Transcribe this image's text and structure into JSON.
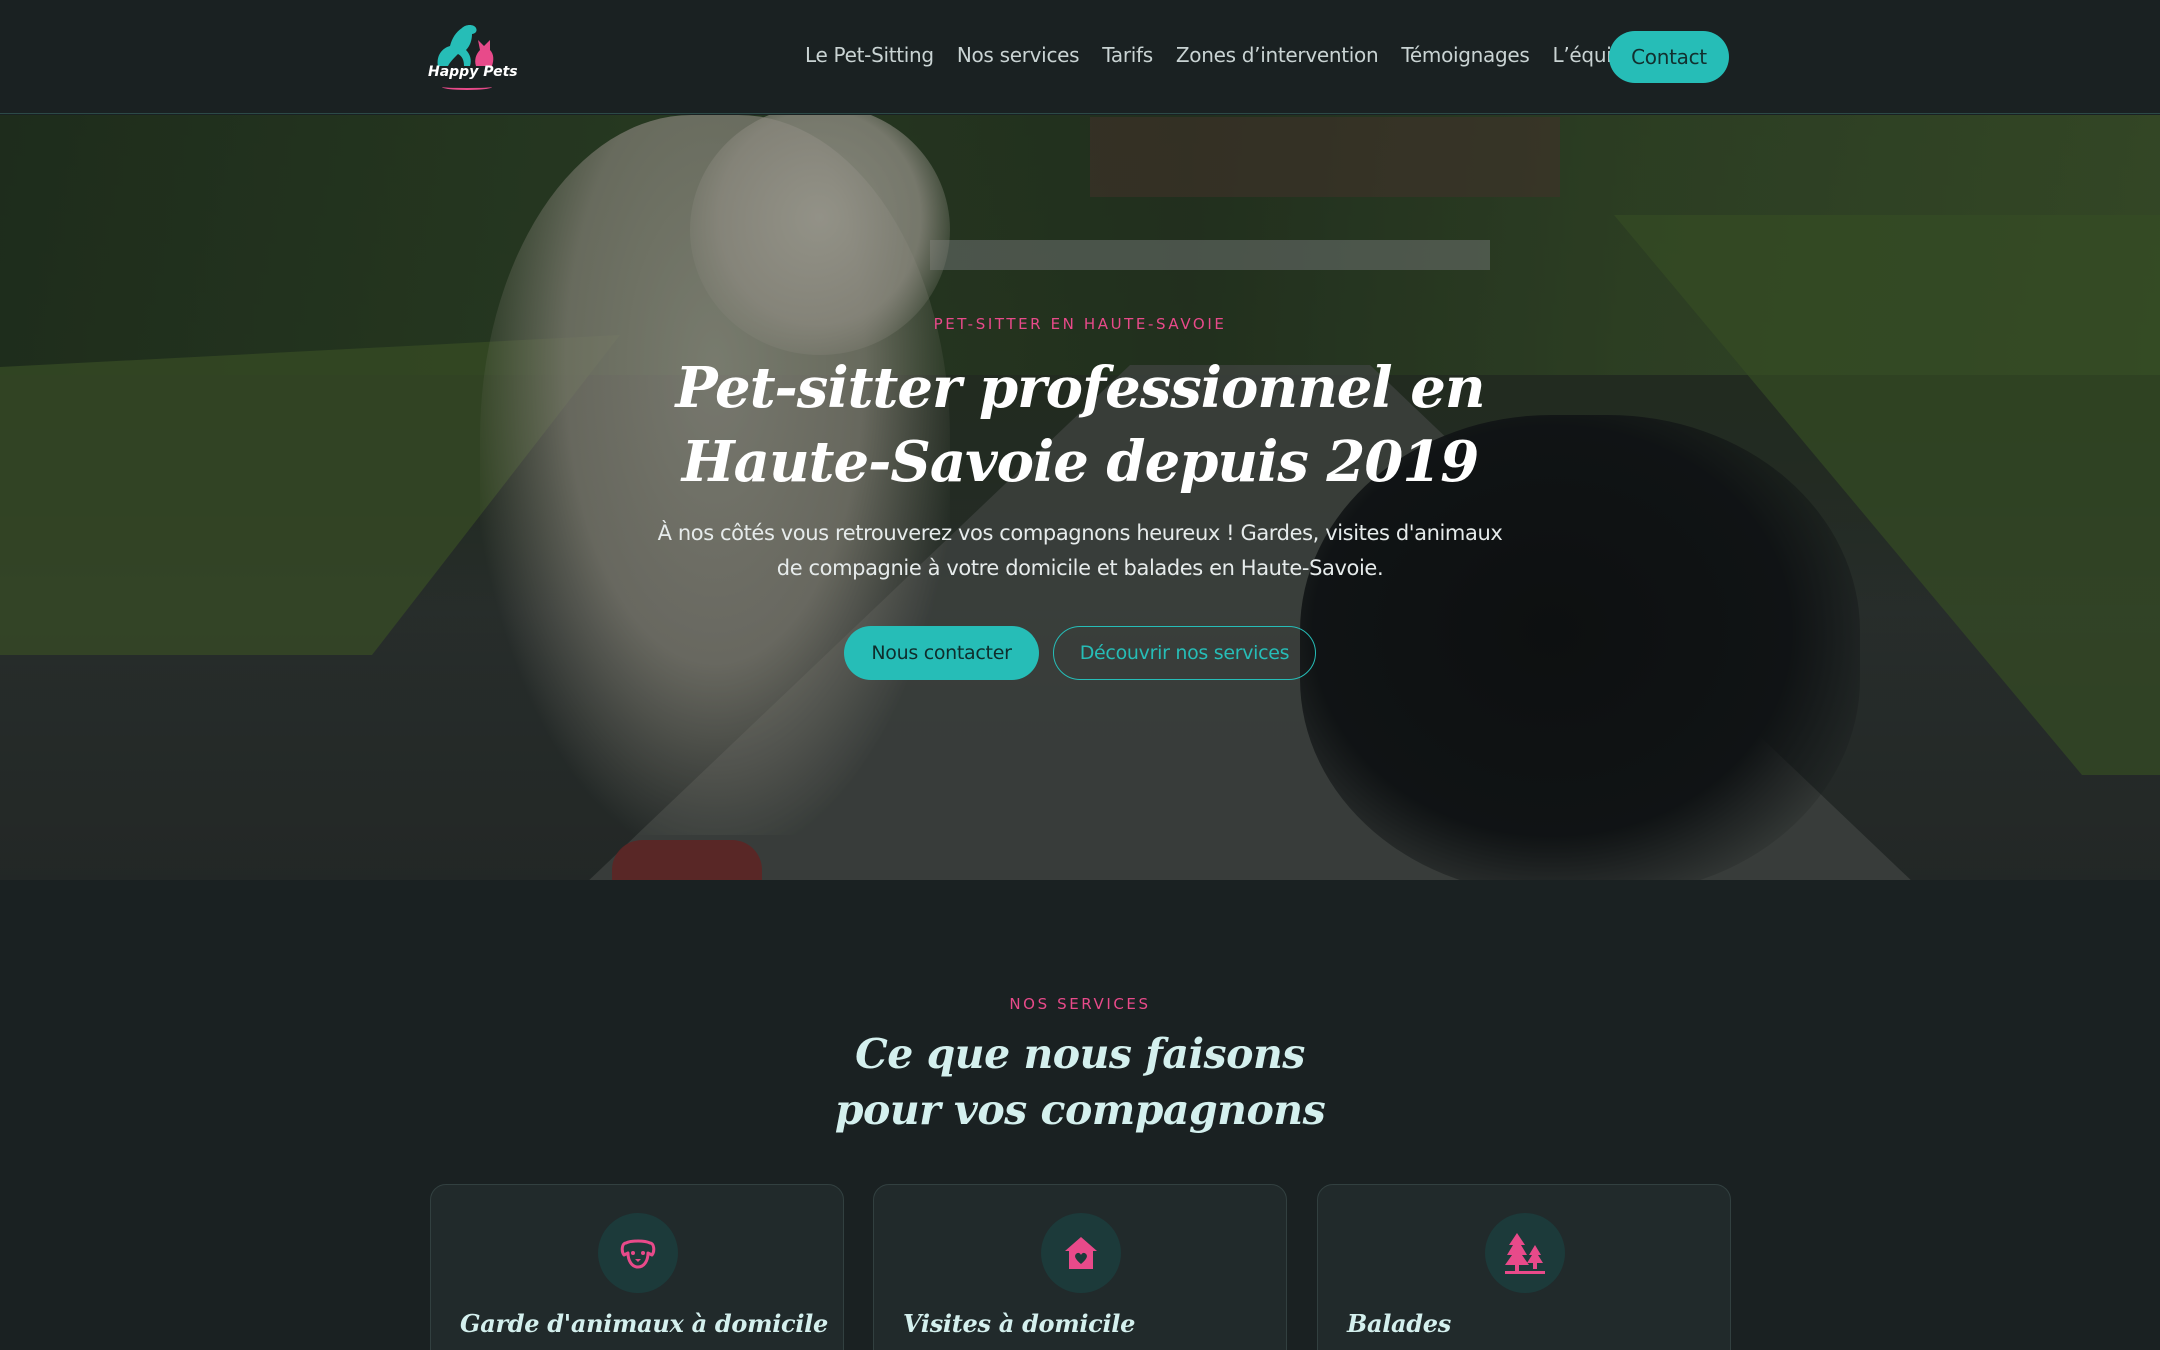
{
  "brand": {
    "logo_text": "Happy Pets",
    "accent": "#26bdb7",
    "pink": "#e84a8a"
  },
  "nav": {
    "items": [
      "Le Pet-Sitting",
      "Nos services",
      "Tarifs",
      "Zones d’intervention",
      "Témoignages",
      "L’équipe"
    ],
    "contact_label": "Contact"
  },
  "hero": {
    "kicker": "PET-SITTER EN HAUTE-SAVOIE",
    "title_line1": "Pet-sitter professionnel en",
    "title_line2": "Haute-Savoie depuis 2019",
    "subtitle_line1": "À nos côtés vous retrouverez vos compagnons heureux ! Gardes, visites d'animaux",
    "subtitle_line2": "de compagnie à votre domicile et balades en Haute-Savoie.",
    "primary_cta": "Nous contacter",
    "secondary_cta": "Découvrir nos services"
  },
  "services": {
    "kicker": "NOS SERVICES",
    "title_line1": "Ce que nous faisons",
    "title_line2": "pour vos compagnons",
    "cards": [
      {
        "title": "Garde d'animaux à domicile",
        "icon": "dog-face-icon"
      },
      {
        "title": "Visites à domicile",
        "icon": "house-heart-icon"
      },
      {
        "title": "Balades",
        "icon": "trees-icon"
      }
    ]
  }
}
